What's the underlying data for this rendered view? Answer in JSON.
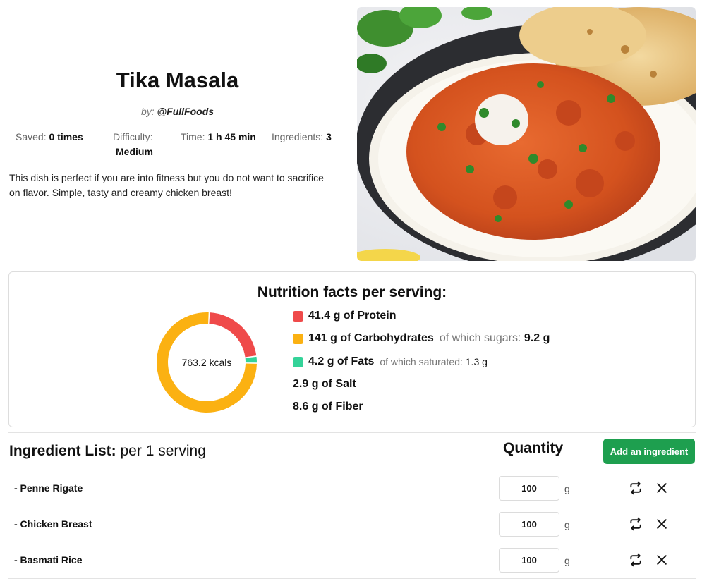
{
  "recipe": {
    "title": "Tika Masala",
    "author_prefix": "by:",
    "author_handle": "@FullFoods",
    "description": "This dish is perfect if you are into fitness but you do not want to sacrifice on flavor. Simple, tasty and creamy chicken breast!",
    "photo_alt": "Tikka masala with rice and naan"
  },
  "stats": {
    "saved_label": "Saved:",
    "saved_value": "0 times",
    "difficulty_label": "Difficulty:",
    "difficulty_value": "Medium",
    "time_label": "Time:",
    "time_value": "1 h 45 min",
    "ingredients_label": "Ingredients:",
    "ingredients_value": "3"
  },
  "nutrition": {
    "title": "Nutrition facts per serving:",
    "kcals": "763.2 kcals",
    "protein": "41.4 g of Protein",
    "carbs": "141 g of Carbohydrates",
    "sugars_label": "of which sugars:",
    "sugars_value": "9.2 g",
    "fats": "4.2 g of Fats",
    "saturated_label": "of which saturated:",
    "saturated_value": "1.3 g",
    "salt": "2.9 g of Salt",
    "fiber": "8.6 g of Fiber",
    "colors": {
      "protein": "#ef4a4a",
      "carbs": "#fbb112",
      "fats": "#34d399"
    },
    "donut_values": {
      "protein": 41.4,
      "carbs": 141,
      "fats": 4.2
    }
  },
  "ingredients": {
    "title": "Ingredient List:",
    "serving": " per 1 serving",
    "quantity_header": "Quantity",
    "add_button": "Add an ingredient",
    "items": [
      {
        "name": "- Penne Rigate",
        "qty": "100",
        "unit": "g"
      },
      {
        "name": "- Chicken Breast",
        "qty": "100",
        "unit": "g"
      },
      {
        "name": "- Basmati Rice",
        "qty": "100",
        "unit": "g"
      }
    ]
  },
  "icons": {
    "swap": "swap-icon",
    "remove": "close-icon"
  }
}
